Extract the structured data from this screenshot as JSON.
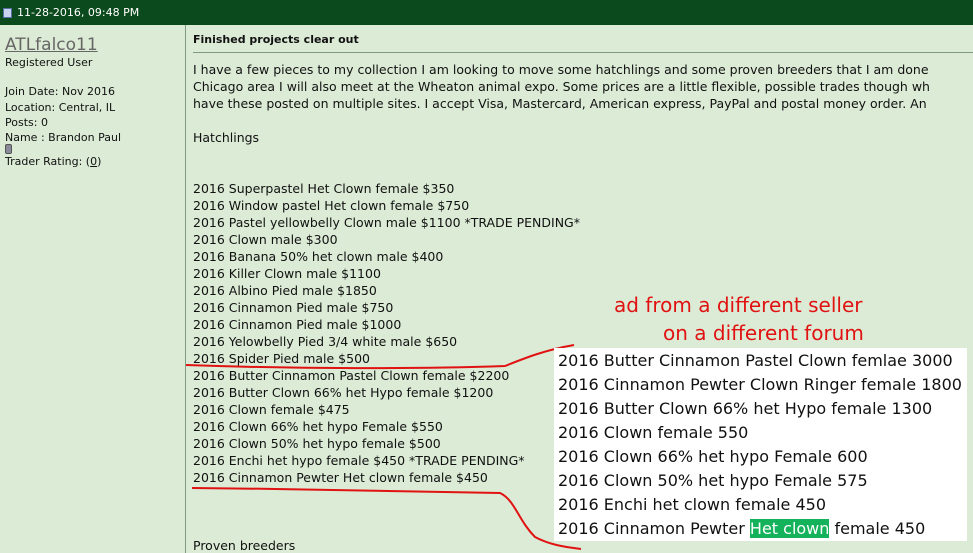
{
  "header": {
    "datetime": "11-28-2016, 09:48 PM"
  },
  "user": {
    "username": "ATLfalco11",
    "title": "Registered User",
    "join_date": "Join Date: Nov 2016",
    "location": "Location: Central, IL",
    "posts": "Posts: 0",
    "name": "Name : Brandon Paul",
    "trader_rating_label": "Trader Rating: (",
    "trader_rating_value": "0",
    "trader_rating_close": ")"
  },
  "post": {
    "title": "Finished projects clear out",
    "intro": [
      "I have a few pieces to my collection I am looking to move some hatchlings and some proven breeders that I am done",
      "Chicago area I will also meet at the Wheaton animal expo. Some prices are a little flexible, possible trades though wh",
      "have these posted on multiple sites. I accept Visa, Mastercard, American express, PayPal and postal money order. An"
    ],
    "hatchlings_heading": "Hatchlings",
    "items": [
      "2016 Superpastel Het Clown female $350",
      "2016 Window pastel Het clown female $750",
      "2016 Pastel yellowbelly Clown male $1100 *TRADE PENDING*",
      "2016 Clown male $300",
      "2016 Banana 50% het clown male $400",
      "2016 Killer Clown male $1100",
      "2016 Albino Pied male $1850",
      "2016 Cinnamon Pied male $750",
      "2016 Cinnamon Pied male $1000",
      "2016 Yelowbelly Pied 3/4 white male $650",
      "2016 Spider Pied male $500",
      "2016 Butter Cinnamon Pastel Clown female $2200",
      "2016 Butter Clown 66% het Hypo female $1200",
      "2016 Clown female $475",
      "2016 Clown 66% het hypo Female $550",
      "2016 Clown 50% het hypo female $500",
      "2016 Enchi het hypo female $450 *TRADE PENDING*",
      "2016 Cinnamon Pewter Het clown female $450"
    ],
    "proven_heading": "Proven breeders"
  },
  "annotation": {
    "line1": "ad from a different seller",
    "line2": "on a different forum",
    "color": "#e01212"
  },
  "overlay": {
    "items": [
      "2016 Butter Cinnamon Pastel Clown femlae 3000",
      "2016 Cinnamon Pewter Clown Ringer female 1800",
      "2016 Butter Clown 66% het Hypo female 1300",
      "2016 Clown female 550",
      "2016 Clown 66% het hypo Female 600",
      "2016 Clown 50% het hypo Female 575",
      "2016 Enchi het clown female 450"
    ],
    "last_prefix": "2016 Cinnamon Pewter ",
    "last_highlight": "Het clown",
    "last_suffix": " female 450",
    "highlight_color": "#14b25a"
  }
}
